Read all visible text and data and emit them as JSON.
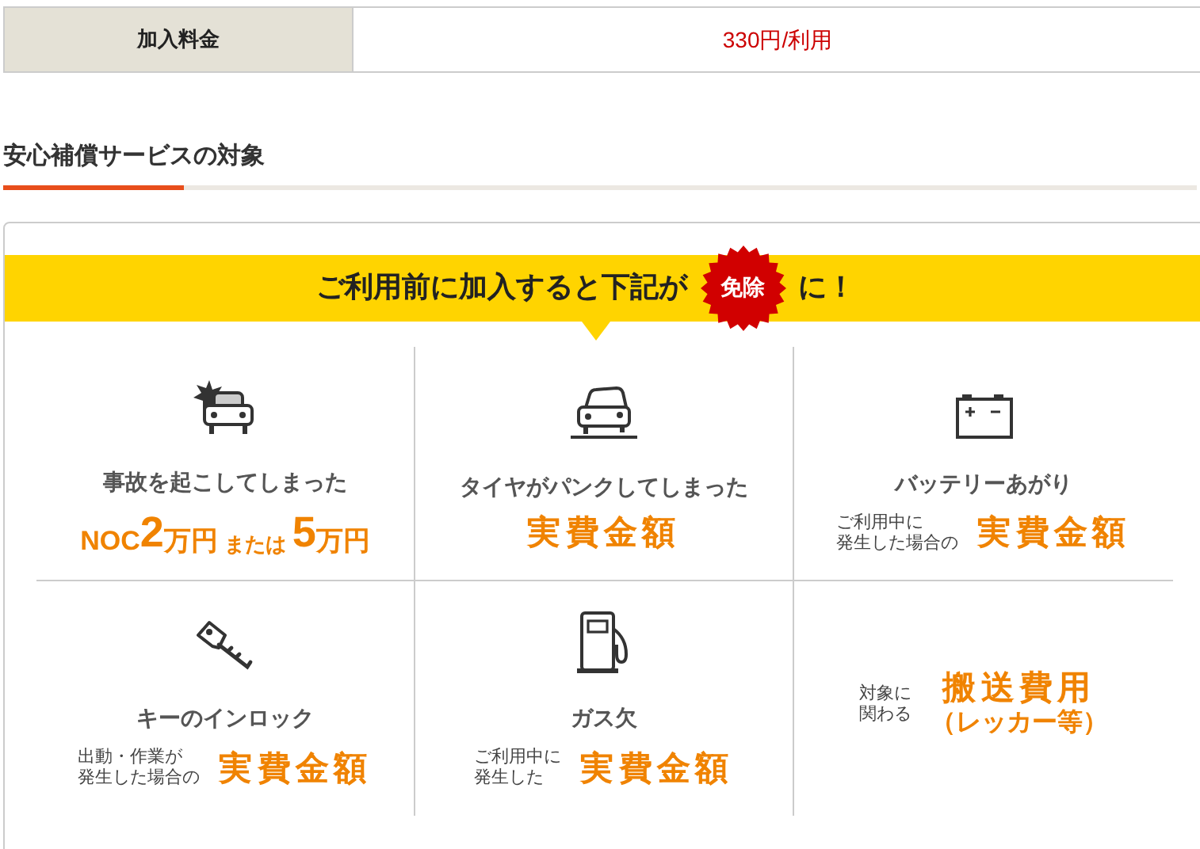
{
  "fee_row": {
    "label": "加入料金",
    "value": "330円/利用"
  },
  "section_title": "安心補償サービスの対象",
  "banner": {
    "lead": "ご利用前に加入すると下記が",
    "badge": "免除",
    "tail": "に！"
  },
  "items": [
    {
      "title": "事故を起こしてしまった",
      "amount_parts": [
        {
          "text": "NOC",
          "kind": "mid"
        },
        {
          "text": "2",
          "kind": "big"
        },
        {
          "text": "万円",
          "kind": "mid"
        },
        {
          "text": "または",
          "kind": "small"
        },
        {
          "text": "5",
          "kind": "big"
        },
        {
          "text": "万円",
          "kind": "mid"
        }
      ]
    },
    {
      "title": "タイヤがパンクしてしまった",
      "amount_parts": [
        {
          "text": "実費金額",
          "kind": "wide"
        }
      ]
    },
    {
      "title": "バッテリーあがり",
      "note_lines": [
        "ご利用中に",
        "発生した場合の"
      ],
      "amount_parts": [
        {
          "text": "実費金額",
          "kind": "wide"
        }
      ]
    },
    {
      "title": "キーのインロック",
      "note_lines": [
        "出動・作業が",
        "発生した場合の"
      ],
      "amount_parts": [
        {
          "text": "実費金額",
          "kind": "wide"
        }
      ]
    },
    {
      "title": "ガス欠",
      "note_lines": [
        "ご利用中に",
        "発生した"
      ],
      "amount_parts": [
        {
          "text": "実費金額",
          "kind": "wide"
        }
      ]
    },
    {
      "note_lines": [
        "対象に",
        "関わる"
      ],
      "amount_parts": [
        {
          "text": "搬送費用",
          "kind": "wide"
        },
        {
          "text": "（レッカー等）",
          "kind": "line"
        }
      ]
    }
  ]
}
